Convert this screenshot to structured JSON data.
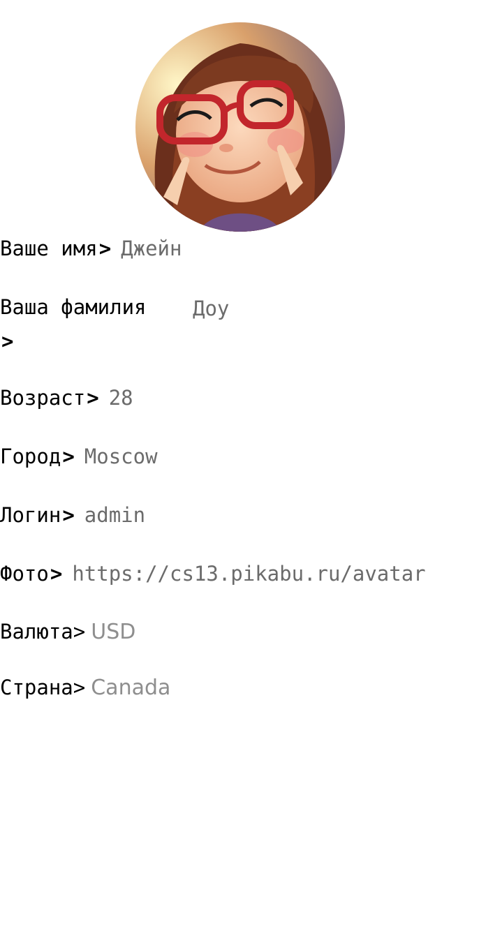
{
  "profile": {
    "avatar_alt": "avatar",
    "fields": {
      "name": {
        "label": "Ваше имя",
        "arrow": ">",
        "value": "Джейн"
      },
      "surname": {
        "label": "Ваша фамилия",
        "arrow": ">",
        "value": "Доу"
      },
      "age": {
        "label": "Возраст",
        "arrow": ">",
        "value": "28"
      },
      "city": {
        "label": "Город",
        "arrow": ">",
        "value": "Moscow"
      },
      "login": {
        "label": "Логин",
        "arrow": ">",
        "value": "admin"
      },
      "photo": {
        "label": "Фото",
        "arrow": ">",
        "value": "https://cs13.pikabu.ru/avatar"
      },
      "currency": {
        "label": "Валюта",
        "arrow": ">",
        "value": "USD"
      },
      "country": {
        "label": "Страна",
        "arrow": ">",
        "value": "Canada"
      }
    }
  },
  "colors": {
    "label": "#000000",
    "value": "#6b6b6b",
    "value_light": "#8e8e8e",
    "background": "#ffffff"
  }
}
